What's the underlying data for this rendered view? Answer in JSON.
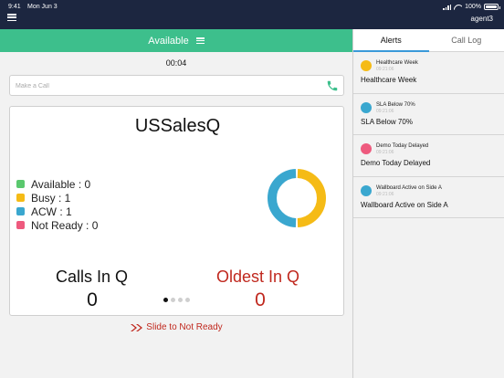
{
  "status_bar": {
    "time": "9:41",
    "date": "Mon Jun 3",
    "battery": "100%",
    "battery_level": 1.0
  },
  "header": {
    "agent": "agent3"
  },
  "availability": {
    "label": "Available",
    "timer": "00:04"
  },
  "call_input": {
    "placeholder": "Make a Call",
    "value": ""
  },
  "queue": {
    "title": "USSalesQ",
    "legend": [
      {
        "label": "Available : 0",
        "color": "#5ac86e",
        "value": 0
      },
      {
        "label": "Busy : 1",
        "color": "#f5bb16",
        "value": 1
      },
      {
        "label": "ACW : 1",
        "color": "#3aa7cf",
        "value": 1
      },
      {
        "label": "Not Ready : 0",
        "color": "#ee5a7e",
        "value": 0
      }
    ],
    "calls_in_q_label": "Calls In Q",
    "calls_in_q_value": "0",
    "oldest_in_q_label": "Oldest In Q",
    "oldest_in_q_value": "0",
    "pager": {
      "pages": 4,
      "active": 0
    }
  },
  "slide_action": "Slide to Not Ready",
  "sidebar": {
    "tabs": [
      {
        "label": "Alerts",
        "active": true
      },
      {
        "label": "Call Log",
        "active": false
      }
    ],
    "alerts": [
      {
        "name": "Healthcare Week",
        "time": "09:21:06",
        "text": "Healthcare Week",
        "color": "#f5bb16"
      },
      {
        "name": "SLA Below 70%",
        "time": "09:21:06",
        "text": "SLA Below 70%",
        "color": "#3aa7cf"
      },
      {
        "name": "Demo Today Delayed",
        "time": "09:21:06",
        "text": "Demo Today Delayed",
        "color": "#ee5a7e"
      },
      {
        "name": "Wallboard Active on Side A",
        "time": "09:21:06",
        "text": "Wallboard Active on Side A",
        "color": "#3aa7cf"
      }
    ]
  },
  "colors": {
    "header_bg": "#1c2640",
    "availability_bg": "#3dbf8c",
    "accent_red": "#c0281e",
    "tab_indicator": "#3a9ad9"
  }
}
